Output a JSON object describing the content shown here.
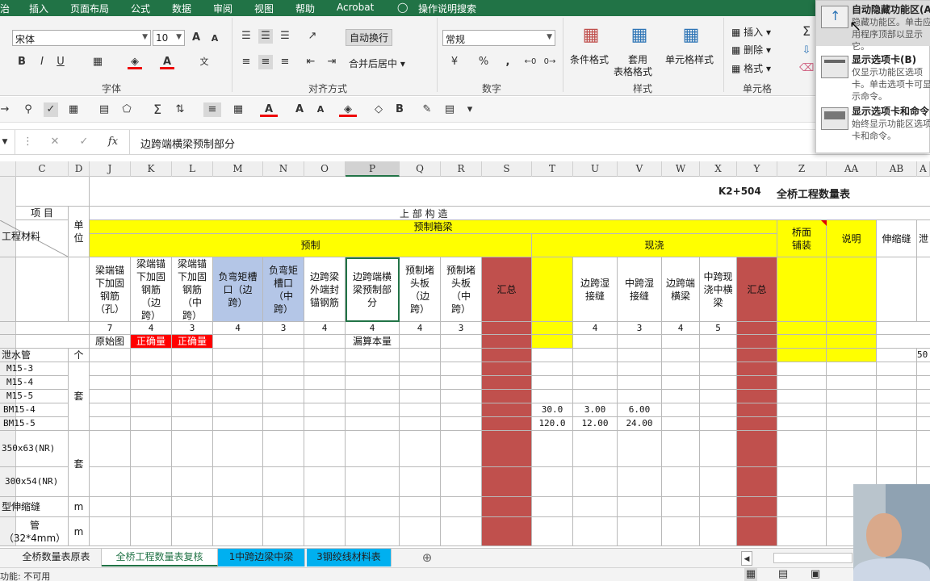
{
  "menu": {
    "items": [
      "治",
      "插入",
      "页面布局",
      "公式",
      "数据",
      "审阅",
      "视图",
      "帮助",
      "Acrobat",
      "操作说明搜索"
    ]
  },
  "ribbon": {
    "font_name": "宋体",
    "font_size": "10",
    "wrap_text": "自动换行",
    "merge_center": "合并后居中",
    "number_format": "常规",
    "conditional_format": "条件格式",
    "table_format_1": "套用",
    "table_format_2": "表格格式",
    "cell_style": "单元格样式",
    "insert": "插入",
    "delete": "删除",
    "format": "格式",
    "groups": {
      "font": "字体",
      "alignment": "对齐方式",
      "number": "数字",
      "styles": "样式",
      "cells": "单元格"
    },
    "bold": "B",
    "italic": "I",
    "underline": "U",
    "grow": "A",
    "shrink": "A",
    "percent": "%",
    "comma": ","
  },
  "popup": {
    "items": [
      {
        "title": "自动隐藏功能区(A)",
        "desc": "隐藏功能区。单击应用程序顶部以显示它。"
      },
      {
        "title": "显示选项卡(B)",
        "desc": "仅显示功能区选项卡。单击选项卡可显示命令。"
      },
      {
        "title": "显示选项卡和命令",
        "desc": "始终显示功能区选项卡和命令。"
      }
    ]
  },
  "formula_bar": {
    "fx": "fx",
    "content": "边跨端横梁预制部分"
  },
  "columns": [
    "C",
    "D",
    "J",
    "K",
    "L",
    "M",
    "N",
    "O",
    "P",
    "Q",
    "R",
    "S",
    "T",
    "U",
    "V",
    "W",
    "X",
    "Y",
    "Z",
    "AA",
    "AB",
    "A"
  ],
  "sheet": {
    "title_code": "K2+504",
    "title": "全桥工程数量表",
    "hdr_item": "项    目",
    "hdr_unit": "单\n位",
    "hdr_material": "工程材料",
    "hdr_upper": "上          部          构          造",
    "hdr_box": "预制箱梁",
    "hdr_precast": "预制",
    "hdr_castinplace": "现浇",
    "hdr_deck": "桥面\n铺装",
    "hdr_note": "说明",
    "hdr_joint": "伸缩缝",
    "hdr_cut": "泄",
    "sub": [
      "梁端锚\n下加固\n钢筋\n（孔）",
      "梁端锚\n下加固\n钢筋\n（边\n跨）",
      "梁端锚\n下加固\n钢筋\n（中\n跨）",
      "负弯矩槽\n口（边\n跨）",
      "负弯矩\n槽口\n（中\n跨）",
      "边跨梁\n外端封\n锚钢筋",
      "边跨端横\n梁预制部\n分",
      "预制堵\n头板\n（边\n跨）",
      "预制堵\n头板\n（中\n跨）",
      "汇总",
      "",
      "边跨湿\n接缝",
      "中跨湿\n接缝",
      "边跨端\n横梁",
      "中跨现\n浇中横\n梁",
      "汇总"
    ],
    "counts": [
      "7",
      "4",
      "3",
      "4",
      "3",
      "4",
      "4",
      "4",
      "3",
      "",
      "",
      "4",
      "3",
      "4",
      "5",
      ""
    ],
    "notes": [
      "原始图",
      "正确量",
      "正确量",
      "",
      "",
      "",
      "漏算本量"
    ],
    "rows": {
      "pipe": "泄水管",
      "pipe_unit": "个",
      "pipe_extra": "50",
      "m153": "M15-3",
      "m154": "M15-4",
      "m155": "M15-5",
      "bm154": "BM15-4",
      "bm155": "BM15-5",
      "set": "套",
      "v1": "30.0",
      "v2": "3.00",
      "v3": "6.00",
      "v4": "120.0",
      "v5": "12.00",
      "v6": "24.00",
      "p1": "350x63(NR)",
      "p2": "300x54(NR)",
      "set2": "套",
      "joint": "型伸缩缝",
      "joint_unit": "m",
      "tube": "管（32*4mm）",
      "tube_unit": "m"
    }
  },
  "tabs": [
    "全桥数量表原表",
    "全桥工程数量表复核",
    "1中跨边梁中梁",
    "3钢绞线材料表"
  ],
  "status": {
    "text": "功能: 不可用"
  },
  "colors": {
    "accent": "#217346",
    "yellow": "#ffff00",
    "red_fill": "#c0504d",
    "blue_fill": "#b4c6e7",
    "tab_cyan": "#00b0f0"
  }
}
